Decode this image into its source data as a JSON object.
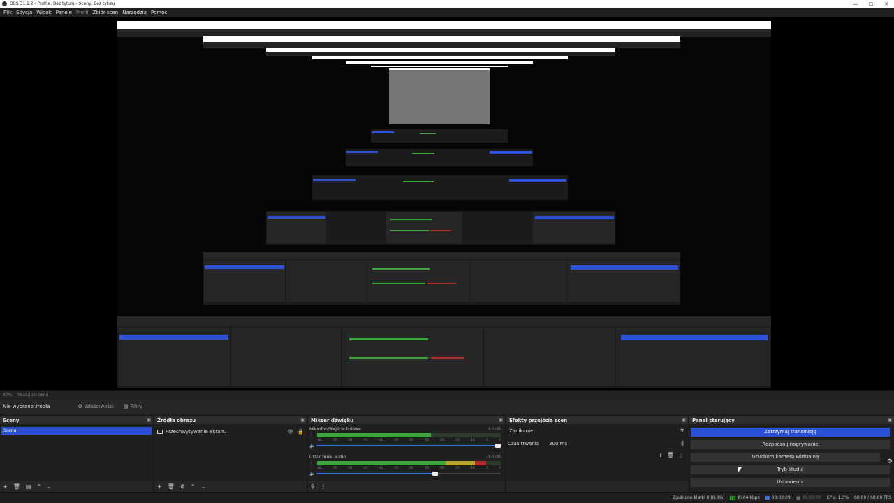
{
  "window": {
    "title": "OBS 31.1.2 - Profile: Bez tytułu - Sceny: Bez tytułu",
    "minimize": "—",
    "maximize": "☐",
    "close": "✕"
  },
  "menu": [
    "Plik",
    "Edycja",
    "Widok",
    "Panele",
    "Profil",
    "Zbiór scen",
    "Narzędzia",
    "Pomoc"
  ],
  "preview_bar": {
    "zoom": "97%",
    "fit": "Skaluj do okna"
  },
  "props_bar": {
    "no_source": "Nie wybrano źródła",
    "properties": "Właściwości",
    "filters": "Filtry"
  },
  "scenes": {
    "title": "Sceny",
    "items": [
      "Scena"
    ]
  },
  "sources": {
    "title": "Źródła obrazu",
    "items": [
      {
        "label": "Przechwytywanie ekranu"
      }
    ]
  },
  "mixer": {
    "title": "Mikser dźwięku",
    "tracks": [
      {
        "name": "Mikrofon/Wejście liniowe",
        "db": "0.0 dB",
        "level": 0.62,
        "volume": 1.0
      },
      {
        "name": "Urządzenie audio",
        "db": "-0.0 dB",
        "level": 0.92,
        "volume": 0.66
      }
    ],
    "scale": [
      "-60",
      "-55",
      "-50",
      "-45",
      "-40",
      "-35",
      "-30",
      "-25",
      "-20",
      "-15",
      "-10",
      "-5",
      "0"
    ]
  },
  "transitions": {
    "title": "Efekty przejścia scen",
    "selected": "Zanikanie",
    "duration_label": "Czas trwania",
    "duration_value": "300 ms"
  },
  "controls": {
    "title": "Panel sterujący",
    "stop_stream": "Zatrzymaj transmisję",
    "start_record": "Rozpocznij nagrywanie",
    "virtual_cam": "Uruchom kamerę wirtualną",
    "studio_mode": "Tryb studia",
    "settings": "Ustawienia"
  },
  "status": {
    "dropped": "Zgubione klatki 0 (0.0%)",
    "bitrate": "8184 kbps",
    "stream_time": "00:03:09",
    "record_time": "00:00:00",
    "cpu": "CPU: 1.3%",
    "fps": "60.00 / 60.00 FPS"
  },
  "colors": {
    "accent": "#2b4fd6",
    "meter_green": "#3da63d",
    "meter_yellow": "#b5a62a",
    "meter_red": "#b52a2a"
  }
}
